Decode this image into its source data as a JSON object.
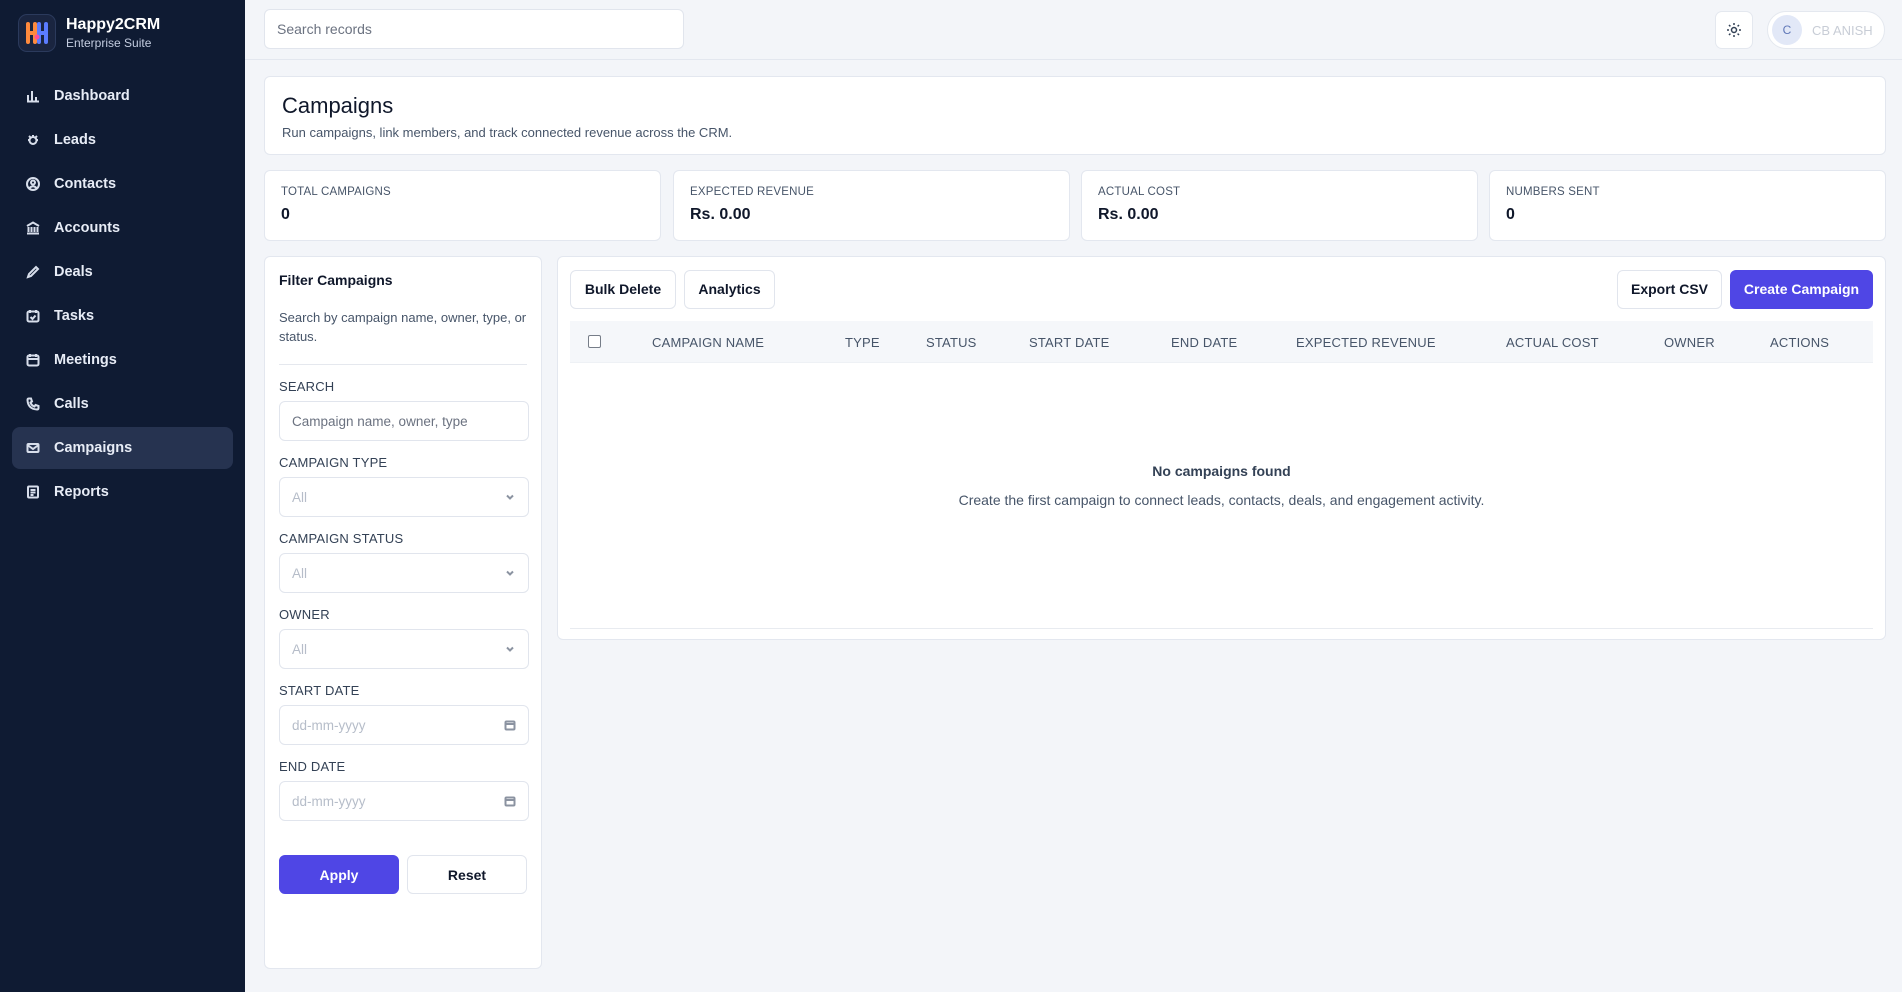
{
  "app": {
    "name": "Happy2CRM",
    "subtitle": "Enterprise Suite"
  },
  "sidebar": {
    "items": [
      {
        "label": "Dashboard",
        "icon": "chart-icon"
      },
      {
        "label": "Leads",
        "icon": "bug-icon"
      },
      {
        "label": "Contacts",
        "icon": "user-circle-icon"
      },
      {
        "label": "Accounts",
        "icon": "bank-icon"
      },
      {
        "label": "Deals",
        "icon": "pen-icon"
      },
      {
        "label": "Tasks",
        "icon": "calendar-check-icon"
      },
      {
        "label": "Meetings",
        "icon": "calendar-icon"
      },
      {
        "label": "Calls",
        "icon": "phone-icon"
      },
      {
        "label": "Campaigns",
        "icon": "mail-icon",
        "active": true
      },
      {
        "label": "Reports",
        "icon": "report-icon"
      }
    ]
  },
  "topbar": {
    "search_placeholder": "Search records",
    "user_initial": "C",
    "user_name": "CB ANISH"
  },
  "header": {
    "title": "Campaigns",
    "subtitle": "Run campaigns, link members, and track connected revenue across the CRM."
  },
  "stats": [
    {
      "label": "TOTAL CAMPAIGNS",
      "value": "0"
    },
    {
      "label": "EXPECTED REVENUE",
      "value": "Rs. 0.00"
    },
    {
      "label": "ACTUAL COST",
      "value": "Rs. 0.00"
    },
    {
      "label": "NUMBERS SENT",
      "value": "0"
    }
  ],
  "filter": {
    "title": "Filter Campaigns",
    "description": "Search by campaign name, owner, type, or status.",
    "search_label": "SEARCH",
    "search_placeholder": "Campaign name, owner, type",
    "type_label": "CAMPAIGN TYPE",
    "type_value": "All",
    "status_label": "CAMPAIGN STATUS",
    "status_value": "All",
    "owner_label": "OWNER",
    "owner_value": "All",
    "start_label": "START DATE",
    "start_placeholder": "dd-mm-yyyy",
    "end_label": "END DATE",
    "end_placeholder": "dd-mm-yyyy",
    "apply": "Apply",
    "reset": "Reset"
  },
  "toolbar": {
    "bulk_delete": "Bulk Delete",
    "analytics": "Analytics",
    "export_csv": "Export CSV",
    "create": "Create Campaign"
  },
  "table": {
    "columns": [
      "CAMPAIGN NAME",
      "TYPE",
      "STATUS",
      "START DATE",
      "END DATE",
      "EXPECTED REVENUE",
      "ACTUAL COST",
      "OWNER",
      "ACTIONS"
    ],
    "empty_title": "No campaigns found",
    "empty_text": "Create the first campaign to connect leads, contacts, deals, and engagement activity."
  },
  "colors": {
    "sidebar_bg": "#0f1b33",
    "accent": "#4f46e5",
    "page_bg": "#f3f5f9"
  }
}
